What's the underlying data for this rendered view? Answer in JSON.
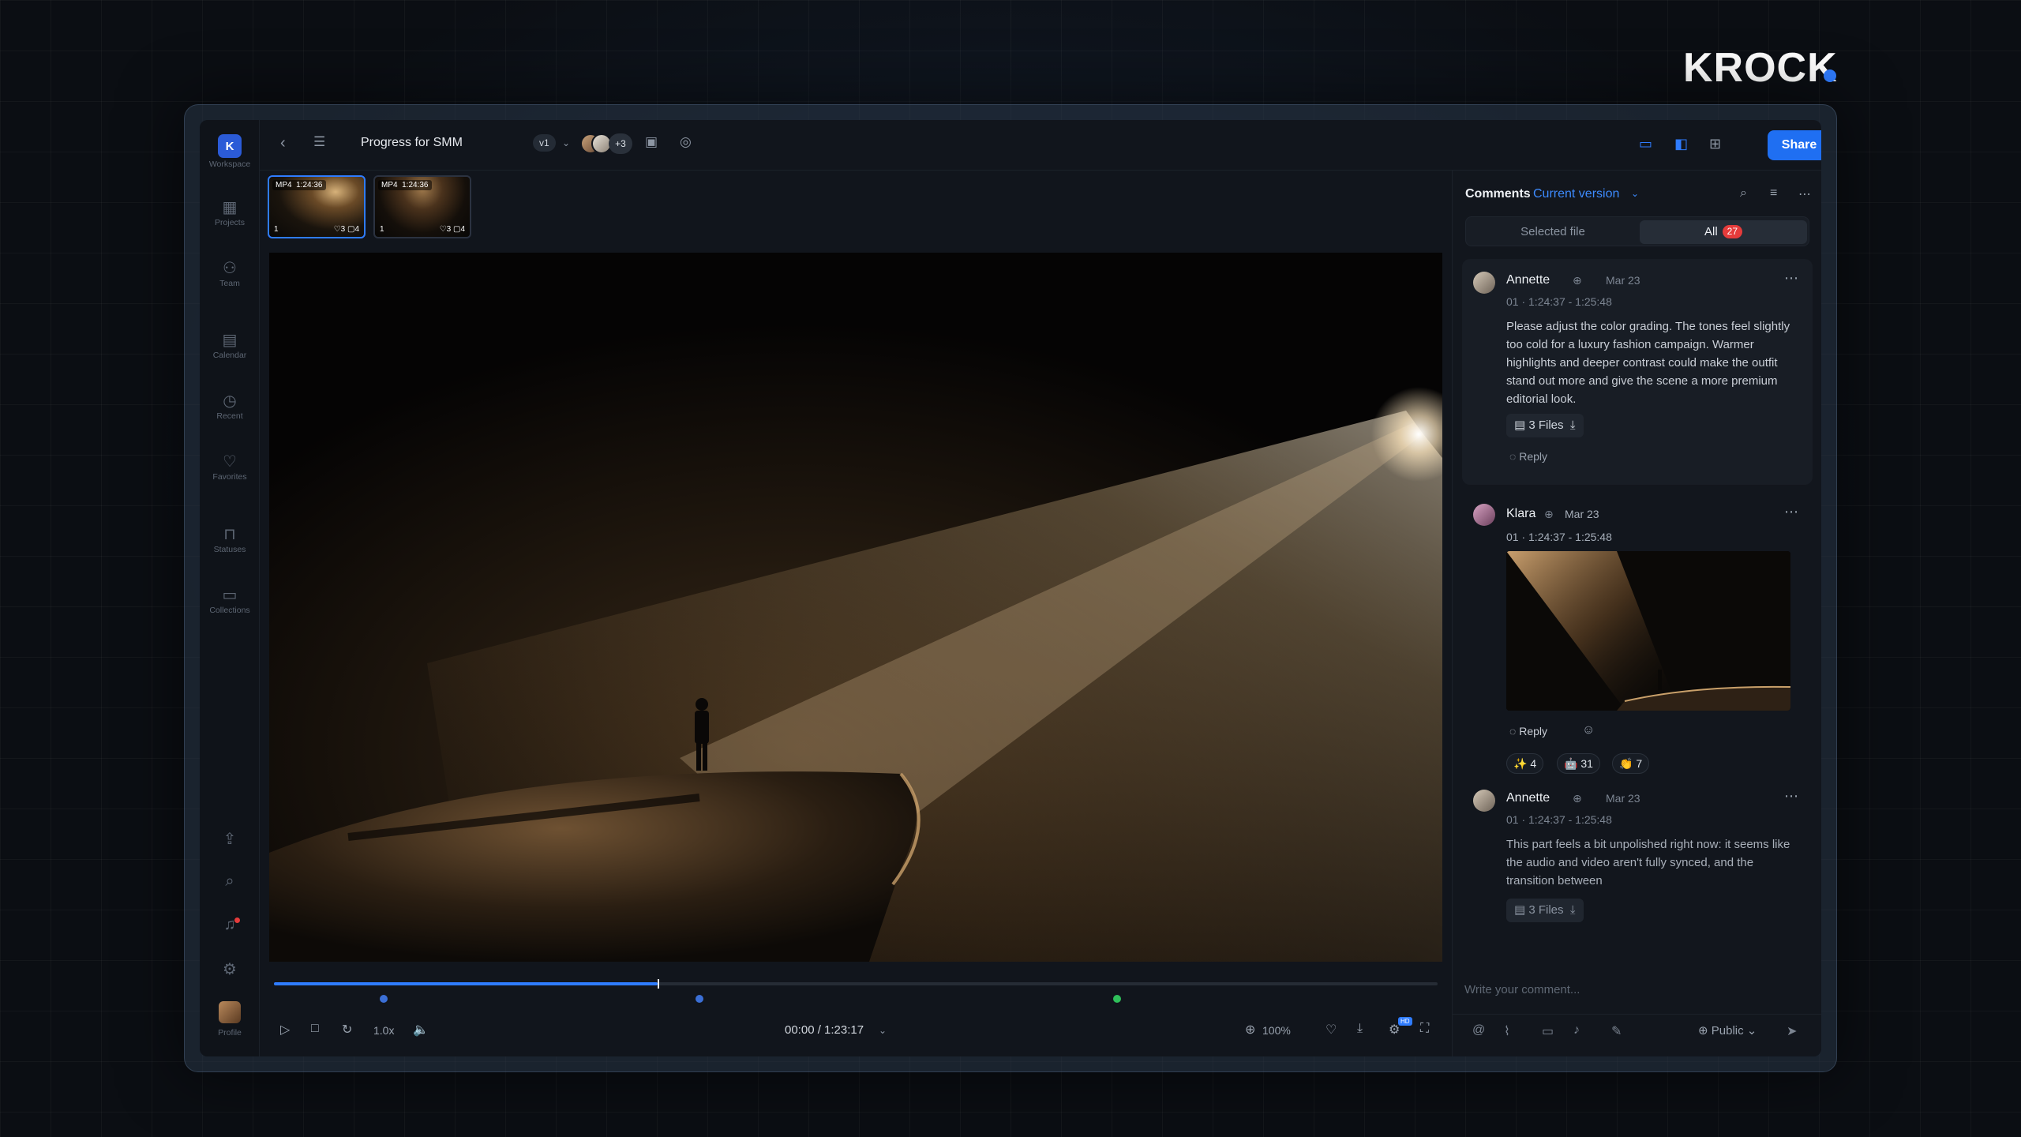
{
  "brand": {
    "name": "KROCK"
  },
  "sidebar": {
    "workspace_initial": "K",
    "items": [
      {
        "label": "Workspace",
        "icon": "workspace-icon"
      },
      {
        "label": "Projects",
        "icon": "projects-icon"
      },
      {
        "label": "Team",
        "icon": "team-icon"
      },
      {
        "label": "Calendar",
        "icon": "calendar-icon"
      },
      {
        "label": "Recent",
        "icon": "clock-icon"
      },
      {
        "label": "Favorites",
        "icon": "heart-icon"
      },
      {
        "label": "Statuses",
        "icon": "bookmark-icon"
      },
      {
        "label": "Collections",
        "icon": "folder-icon"
      }
    ],
    "profile_label": "Profile"
  },
  "topbar": {
    "title": "Progress for SMM",
    "version": "v1",
    "extra_collaborators": "+3",
    "share_label": "Share"
  },
  "thumbnails": [
    {
      "format": "MP4",
      "duration": "1:24:36",
      "index": "1",
      "likes": "3",
      "comments": "4",
      "selected": true
    },
    {
      "format": "MP4",
      "duration": "1:24:36",
      "index": "1",
      "likes": "3",
      "comments": "4",
      "selected": false
    }
  ],
  "player": {
    "progress": 0.33,
    "speed": "1.0x",
    "timecode": "00:00 / 1:23:17",
    "zoom": "100%",
    "hd_badge": "HD",
    "markers": [
      {
        "position": 0.06,
        "color": "#3b6fd6"
      },
      {
        "position": 0.3,
        "color": "#3b6fd6"
      },
      {
        "position": 0.58,
        "color": "#2fbf5a"
      }
    ]
  },
  "comments": {
    "title": "Comments",
    "version_filter": "Current version",
    "tabs": {
      "selected_file": "Selected file",
      "all": "All",
      "all_count": "27"
    },
    "list": [
      {
        "author": "Annette",
        "date": "Mar 23",
        "time_range": "01 · 1:24:37 - 1:25:48",
        "text": "Please adjust the color grading. The tones feel slightly too cold for a luxury fashion campaign. Warmer highlights and deeper contrast could make the outfit stand out more and give the scene a more premium editorial look.",
        "files": "3 Files",
        "reply": "Reply"
      },
      {
        "author": "Klara",
        "date": "Mar 23",
        "time_range": "01 · 1:24:37 - 1:25:48",
        "reply": "Reply",
        "reactions": [
          {
            "emoji": "✨",
            "count": "4"
          },
          {
            "emoji": "🤖",
            "count": "31"
          },
          {
            "emoji": "👏",
            "count": "7"
          }
        ]
      },
      {
        "author": "Annette",
        "date": "Mar 23",
        "time_range": "01 · 1:24:37 - 1:25:48",
        "text": "This part feels a bit unpolished right now: it seems like the audio and video aren't fully synced, and the transition between",
        "files": "3 Files"
      }
    ],
    "composer_placeholder": "Write your comment...",
    "visibility": "Public"
  },
  "colors": {
    "accent": "#1f6ff2",
    "badge": "#e53b3b",
    "marker_green": "#2fbf5a"
  }
}
